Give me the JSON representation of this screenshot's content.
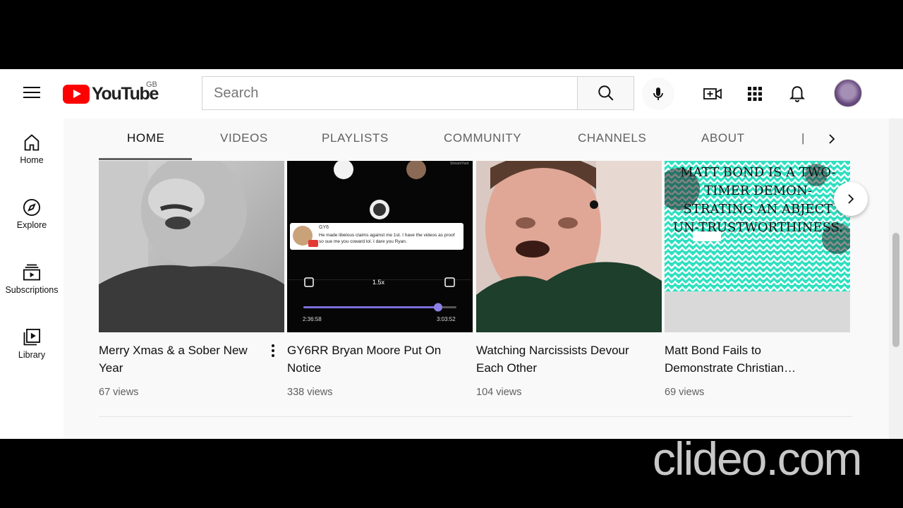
{
  "header": {
    "logo_text": "YouTube",
    "country_code": "GB",
    "search_placeholder": "Search"
  },
  "sidebar": {
    "items": [
      {
        "label": "Home",
        "icon": "home-icon"
      },
      {
        "label": "Explore",
        "icon": "compass-icon"
      },
      {
        "label": "Subscriptions",
        "icon": "subscriptions-icon"
      },
      {
        "label": "Library",
        "icon": "library-icon"
      }
    ]
  },
  "channel_tabs": [
    {
      "label": "HOME",
      "active": true
    },
    {
      "label": "VIDEOS",
      "active": false
    },
    {
      "label": "PLAYLISTS",
      "active": false
    },
    {
      "label": "COMMUNITY",
      "active": false
    },
    {
      "label": "CHANNELS",
      "active": false
    },
    {
      "label": "ABOUT",
      "active": false
    }
  ],
  "videos": [
    {
      "title": "Merry Xmas & a Sober New Year",
      "views": "67 views"
    },
    {
      "title": "GY6RR Bryan Moore Put On Notice",
      "views": "338 views"
    },
    {
      "title": "Watching Narcissists Devour Each Other",
      "views": "104 views"
    },
    {
      "title": "Matt Bond Fails to Demonstrate Christian…",
      "views": "69 views"
    }
  ],
  "thumb2": {
    "user": "GY6",
    "comment": "He made libelous claims against me 1st. I have the videos as proof so sue me you coward lol. I dare you Ryan.",
    "speed": "1.5x",
    "time_current": "2:36:58",
    "time_total": "3:03:52",
    "brand": "StreamYard",
    "progress": 0.88
  },
  "thumb4": {
    "text": "MATT BOND IS A TWO-TIMER DEMON-STRATING AN ABJECT UN-TRUSTWORTHINESS."
  },
  "watermark": "clideo.com"
}
